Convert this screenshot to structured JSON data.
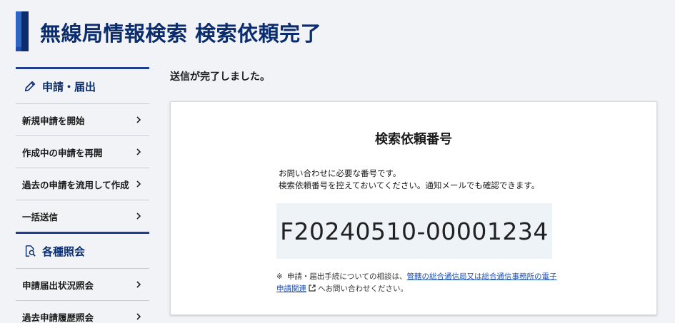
{
  "header": {
    "title": "無線局情報検索 検索依頼完了"
  },
  "sidebar": {
    "sections": [
      {
        "title": "申請・届出",
        "icon": "pencil-icon",
        "items": [
          {
            "label": "新規申請を開始"
          },
          {
            "label": "作成中の申請を再開"
          },
          {
            "label": "過去の申請を流用して作成"
          },
          {
            "label": "一括送信"
          }
        ]
      },
      {
        "title": "各種照会",
        "icon": "search-document-icon",
        "items": [
          {
            "label": "申請届出状況照会"
          },
          {
            "label": "過去申請履歴照会"
          }
        ]
      }
    ]
  },
  "main": {
    "sent_message": "送信が完了しました。",
    "card": {
      "title": "検索依頼番号",
      "desc_line1": "お問い合わせに必要な番号です。",
      "desc_line2": "検索依頼番号を控えておいてください。通知メールでも確認できます。",
      "request_number": "F20240510-00001234",
      "note_mark": "※",
      "note_prefix": "申請・届出手続についての相談は、",
      "note_link": "管轄の総合通信局又は総合通信事務所の電子申請関連",
      "note_suffix": "へお問い合わせください。"
    }
  },
  "colors": {
    "brand": "#0b2d6e",
    "link": "#1a4fb5",
    "number_bg": "#eef3f8"
  }
}
